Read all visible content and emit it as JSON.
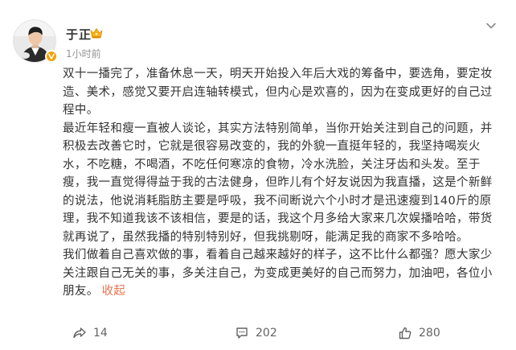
{
  "post": {
    "author": {
      "name": "于正",
      "time": "1小时前"
    },
    "content": {
      "para1": "双十一播完了，准备休息一天，明天开始投入年后大戏的筹备中，要选角，要定妆造、美术，感觉又要开启连轴转模式，但内心是欢喜的，因为在变成更好的自己过程中。",
      "para2": "最近年轻和瘦一直被人谈论，其实方法特别简单，当你开始关注到自己的问题，并积极去改善它时，它就是很容易改变的，我的外貌一直挺年轻的，我坚持喝炭火水，不吃糖，不喝酒，不吃任何寒凉的食物，冷水洗脸，关注牙齿和头发。至于瘦，我一直觉得得益于我的古法健身，但昨儿有个好友说因为我直播，这是个新鲜的说法，他说消耗脂肪主要是呼吸，我不间断说六个小时才是迅速瘦到140斤的原理，我不知道我该不该相信，要是的话，我这个月多给大家来几次娱播哈哈，带货就再说了，虽然我播的特别特别好，但我挑剔呀，能满足我的商家不多哈哈。",
      "para3": "我们做着自己喜欢做的事，看着自己越来越好的样子，这不比什么都强？愿大家少关注跟自己无关的事，多关注自己，为变成更美好的自己而努力，加油吧，各位小朋友。",
      "collapse_label": "收起"
    },
    "actions": {
      "share_count": "14",
      "comment_count": "202",
      "like_count": "280"
    }
  },
  "colors": {
    "text": "#333333",
    "muted": "#939393",
    "accent": "#eb7350",
    "verified": "#f3a001"
  },
  "icons": {
    "verified": "verified-v-icon",
    "crown": "crown-icon",
    "menu": "chevron-down-icon",
    "share": "share-icon",
    "comment": "comment-icon",
    "like": "thumbs-up-icon"
  }
}
